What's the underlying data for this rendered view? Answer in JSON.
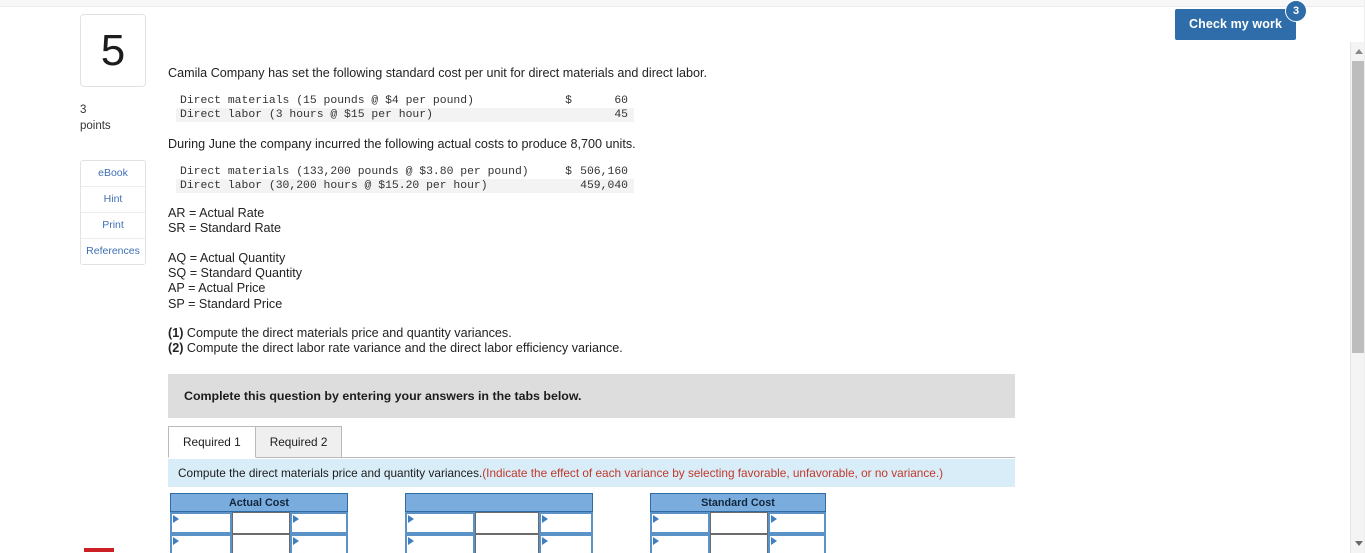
{
  "toolbar": {
    "check_label": "Check my work",
    "check_badge": "3"
  },
  "sidebar": {
    "question_number": "5",
    "points_value": "3",
    "points_label": "points",
    "buttons": [
      {
        "label": "eBook"
      },
      {
        "label": "Hint"
      },
      {
        "label": "Print"
      },
      {
        "label": "References"
      }
    ]
  },
  "question": {
    "intro": "Camila Company has set the following standard cost per unit for direct materials and direct labor.",
    "standard_costs": {
      "rows": [
        {
          "label": "Direct materials (15 pounds @ $4 per pound)",
          "currency": "$",
          "value": "60"
        },
        {
          "label": "Direct labor (3 hours @ $15 per hour)",
          "currency": "",
          "value": "45"
        }
      ]
    },
    "during": "During June the company incurred the following actual costs to produce 8,700 units.",
    "actual_costs": {
      "rows": [
        {
          "label": "Direct materials (133,200 pounds @ $3.80 per pound)",
          "currency": "$",
          "value": "506,160"
        },
        {
          "label": "Direct labor (30,200 hours @ $15.20 per hour)",
          "currency": "",
          "value": "459,040"
        }
      ]
    },
    "definitions_rate": [
      "AR = Actual Rate",
      "SR = Standard Rate"
    ],
    "definitions_qty": [
      "AQ = Actual Quantity",
      "SQ = Standard Quantity",
      "AP = Actual Price",
      "SP = Standard Price"
    ],
    "requirements": [
      {
        "num": "(1)",
        "text": " Compute the direct materials price and quantity variances."
      },
      {
        "num": "(2)",
        "text": " Compute the direct labor rate variance and the direct labor efficiency variance."
      }
    ]
  },
  "answer_area": {
    "banner": "Complete this question by entering your answers in the tabs below.",
    "tabs": [
      {
        "label": "Required 1",
        "active": true
      },
      {
        "label": "Required 2",
        "active": false
      }
    ],
    "instruction_main": "Compute the direct materials price and quantity variances. ",
    "instruction_note": "(Indicate the effect of each variance by selecting favorable, unfavorable, or no variance.)",
    "grid": {
      "headers": {
        "actual_cost": "Actual Cost",
        "middle": "",
        "standard_cost": "Standard Cost"
      }
    }
  },
  "colors": {
    "accent_blue": "#2e6da9",
    "header_blue": "#7aadde",
    "banner_blue": "#d9edf9",
    "banner_grey": "#dddddd",
    "note_red": "#c0392b",
    "link_blue": "#3f6fb5"
  }
}
